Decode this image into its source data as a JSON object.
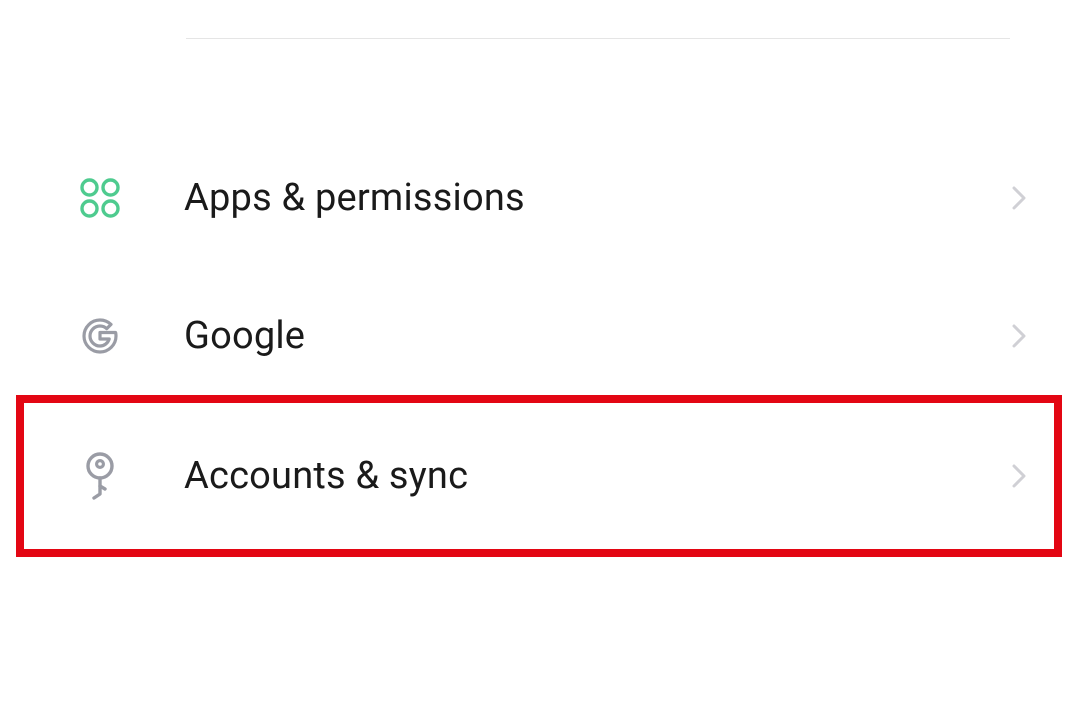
{
  "settings": {
    "items": [
      {
        "label": "Apps & permissions",
        "icon": "squares-icon",
        "highlighted": false
      },
      {
        "label": "Google",
        "icon": "google-icon",
        "highlighted": false
      },
      {
        "label": "Accounts & sync",
        "icon": "key-icon",
        "highlighted": true
      }
    ]
  },
  "colors": {
    "accent_green": "#4ecb8f",
    "icon_gray": "#9a9ca5",
    "chevron_gray": "#d0d0d5",
    "highlight_red": "#e30613"
  }
}
